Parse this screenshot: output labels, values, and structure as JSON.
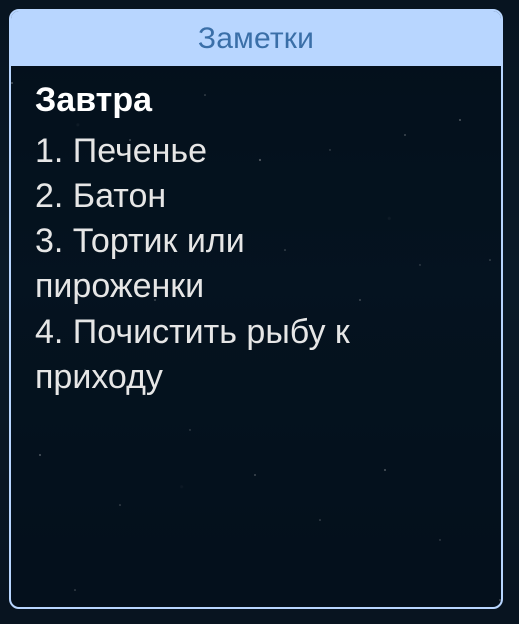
{
  "widget": {
    "header_title": "Заметки",
    "note_title": "Завтра",
    "lines": [
      "1. Печенье",
      "2. Батон",
      "3. Тортик или",
      "пироженки",
      "4. Почистить рыбу к",
      "приходу"
    ]
  }
}
